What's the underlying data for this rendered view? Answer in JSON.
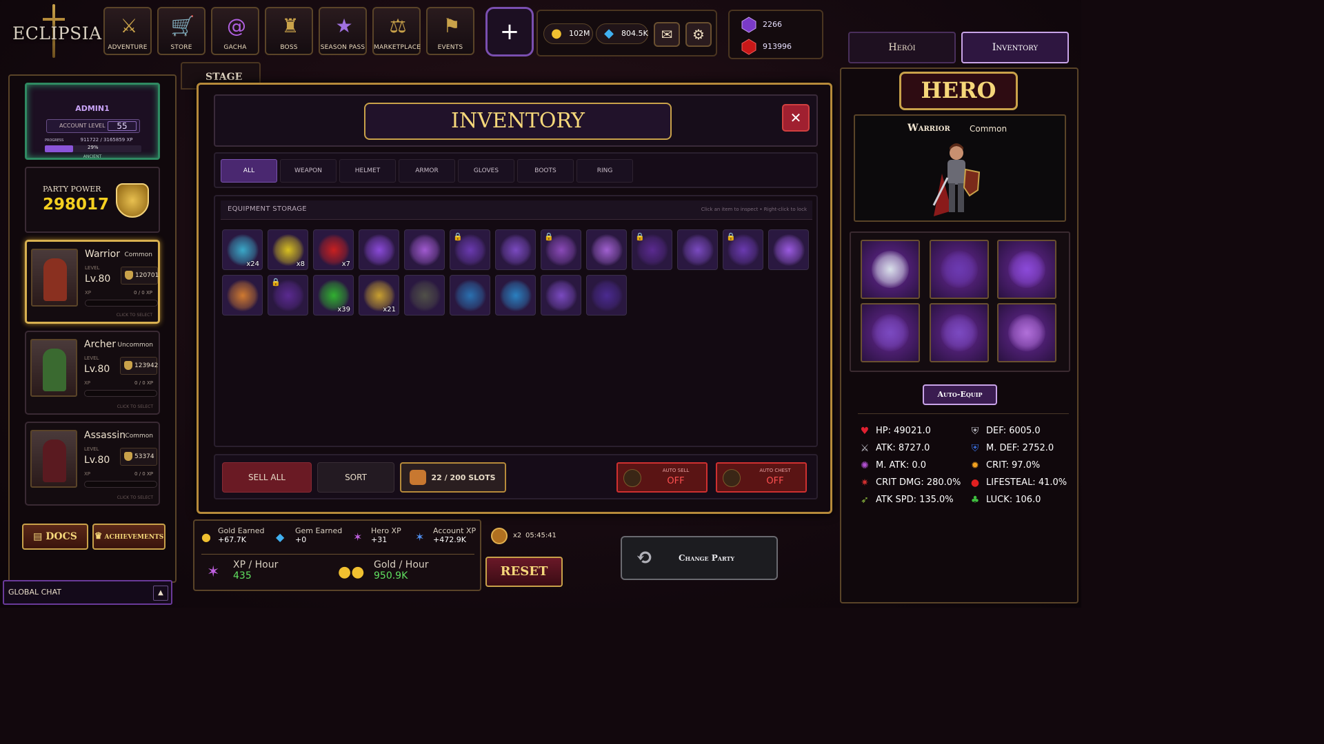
{
  "logo": {
    "text": "ECLIPSIA"
  },
  "nav": [
    {
      "label": "ADVENTURE",
      "icon": "crossed-swords-icon"
    },
    {
      "label": "STORE",
      "icon": "cart-icon"
    },
    {
      "label": "GACHA",
      "icon": "vortex-icon"
    },
    {
      "label": "BOSS",
      "icon": "horned-helmet-icon"
    },
    {
      "label": "SEASON PASS",
      "icon": "star-shield-icon"
    },
    {
      "label": "MARKETPLACE",
      "icon": "scales-icon"
    },
    {
      "label": "EVENTS",
      "icon": "banner-icon"
    }
  ],
  "currency": {
    "gold": "102M",
    "diamonds": "804.5K"
  },
  "gems": {
    "purple": "2266",
    "red": "913996"
  },
  "top_tabs": {
    "heroes": "Herói",
    "inventory": "Inventory"
  },
  "profile": {
    "name": "ADMIN1",
    "account_level_label": "ACCOUNT LEVEL",
    "account_level": "55",
    "progress_label": "PROGRESS",
    "xp_text": "911722 / 3165859 XP",
    "percent_text": "29%",
    "progress_fraction": 0.29,
    "rank": "ANCIENT"
  },
  "party_power": {
    "label": "PARTY POWER",
    "value": "298017"
  },
  "heroes": [
    {
      "name": "Warrior",
      "rarity": "Common",
      "level_label": "LEVEL",
      "level": "Lv.80",
      "power": "120701",
      "xp_label": "XP",
      "xp": "0 / 0 XP",
      "hint": "CLICK TO SELECT",
      "selected": true
    },
    {
      "name": "Archer",
      "rarity": "Uncommon",
      "level_label": "LEVEL",
      "level": "Lv.80",
      "power": "123942",
      "xp_label": "XP",
      "xp": "0 / 0 XP",
      "hint": "CLICK TO SELECT",
      "selected": false
    },
    {
      "name": "Assassin",
      "rarity": "Common",
      "level_label": "LEVEL",
      "level": "Lv.80",
      "power": "53374",
      "xp_label": "XP",
      "xp": "0 / 0 XP",
      "hint": "CLICK TO SELECT",
      "selected": false
    }
  ],
  "buttons": {
    "docs": "DOCS",
    "achievements": "ACHIEVEMENTS"
  },
  "chat": {
    "label": "GLOBAL CHAT",
    "toggle": "▲"
  },
  "stage_tab": "STAGE",
  "inventory": {
    "title": "INVENTORY",
    "close": "✕",
    "filters": [
      "ALL",
      "WEAPON",
      "HELMET",
      "ARMOR",
      "GLOVES",
      "BOOTS",
      "RING"
    ],
    "active_filter": "ALL",
    "storage_label": "EQUIPMENT STORAGE",
    "storage_hint": "Click an item to inspect • Right-click to lock",
    "items": [
      {
        "kind": "staff",
        "color": "#3aa8c8",
        "qty": "x24",
        "locked": false
      },
      {
        "kind": "staff",
        "color": "#d8c020",
        "qty": "x8",
        "locked": false
      },
      {
        "kind": "staff",
        "color": "#c82020",
        "qty": "x7",
        "locked": false
      },
      {
        "kind": "armor",
        "color": "#8a4ad8",
        "qty": "",
        "locked": false
      },
      {
        "kind": "ring",
        "color": "#a05ad0",
        "qty": "",
        "locked": false
      },
      {
        "kind": "gloves",
        "color": "#6a3ab0",
        "qty": "",
        "locked": true
      },
      {
        "kind": "gloves",
        "color": "#7a4ac0",
        "qty": "",
        "locked": false
      },
      {
        "kind": "ring",
        "color": "#8a4ab8",
        "qty": "",
        "locked": true
      },
      {
        "kind": "ring",
        "color": "#a060d0",
        "qty": "",
        "locked": false
      },
      {
        "kind": "armor",
        "color": "#5a2a90",
        "qty": "",
        "locked": true
      },
      {
        "kind": "boots",
        "color": "#7a4ac0",
        "qty": "",
        "locked": false
      },
      {
        "kind": "boots",
        "color": "#6a3ab0",
        "qty": "",
        "locked": true
      },
      {
        "kind": "weapon",
        "color": "#9a5ae0",
        "qty": "",
        "locked": false
      },
      {
        "kind": "hat",
        "color": "#d07a30",
        "qty": "",
        "locked": false
      },
      {
        "kind": "armor",
        "color": "#5a2a90",
        "qty": "",
        "locked": true
      },
      {
        "kind": "staff",
        "color": "#30b030",
        "qty": "x39",
        "locked": false
      },
      {
        "kind": "staff",
        "color": "#c8a030",
        "qty": "x21",
        "locked": false
      },
      {
        "kind": "staff",
        "color": "#505048",
        "qty": "",
        "locked": false
      },
      {
        "kind": "ring",
        "color": "#2a70b0",
        "qty": "",
        "locked": false
      },
      {
        "kind": "ring",
        "color": "#2a80c0",
        "qty": "",
        "locked": false
      },
      {
        "kind": "armor",
        "color": "#7a4ac0",
        "qty": "",
        "locked": false
      },
      {
        "kind": "gloves",
        "color": "#4a2a90",
        "qty": "",
        "locked": false
      }
    ],
    "sell_all": "SELL ALL",
    "sort": "SORT",
    "slots": "22 / 200 SLOTS",
    "auto_sell": {
      "label": "AUTO SELL",
      "value": "OFF"
    },
    "auto_chest": {
      "label": "AUTO CHEST",
      "value": "OFF"
    }
  },
  "stats_bar": {
    "gold_earned_label": "Gold Earned",
    "gold_earned": "+67.7K",
    "gem_earned_label": "Gem Earned",
    "gem_earned": "+0",
    "hero_xp_label": "Hero XP",
    "hero_xp": "+31",
    "account_xp_label": "Account XP",
    "account_xp": "+472.9K",
    "xp_hour_label": "XP / Hour",
    "xp_hour": "435",
    "gold_hour_label": "Gold / Hour",
    "gold_hour": "950.9K",
    "boost": "x2",
    "timer": "05:45:41",
    "reset": "RESET"
  },
  "change_party": "Change Party",
  "hero_panel": {
    "title": "HERO",
    "name": "Warrior",
    "rarity": "Common",
    "equipped": [
      {
        "slot": "helmet",
        "color": "#d8e0e8"
      },
      {
        "slot": "armor",
        "color": "#6a3ab0"
      },
      {
        "slot": "weapon",
        "color": "#8a4ad8"
      },
      {
        "slot": "boots",
        "color": "#7a4ac0"
      },
      {
        "slot": "gloves",
        "color": "#7a4ac0"
      },
      {
        "slot": "ring",
        "color": "#b070d8"
      }
    ],
    "auto_equip": "Auto-Equip",
    "stats": [
      {
        "text": "HP: 49021.0",
        "icon": "heart-icon",
        "color": "#e02030",
        "glyph": "♥"
      },
      {
        "text": "DEF: 6005.0",
        "icon": "shield-icon",
        "color": "#c8c8d0",
        "glyph": "⛨"
      },
      {
        "text": "ATK: 8727.0",
        "icon": "sword-icon",
        "color": "#c8c8d0",
        "glyph": "⚔"
      },
      {
        "text": "M. DEF: 2752.0",
        "icon": "blue-shield-icon",
        "color": "#3a70e0",
        "glyph": "⛨"
      },
      {
        "text": "M. ATK: 0.0",
        "icon": "magic-icon",
        "color": "#b050d0",
        "glyph": "✺"
      },
      {
        "text": "CRIT: 97.0%",
        "icon": "spark-icon",
        "color": "#f0a020",
        "glyph": "✹"
      },
      {
        "text": "CRIT DMG: 280.0%",
        "icon": "burst-icon",
        "color": "#d03030",
        "glyph": "✷"
      },
      {
        "text": "LIFESTEAL: 41.0%",
        "icon": "blood-drop-icon",
        "color": "#e02020",
        "glyph": "●"
      },
      {
        "text": "ATK SPD: 135.0%",
        "icon": "speed-icon",
        "color": "#90c040",
        "glyph": "➶"
      },
      {
        "text": "LUCK: 106.0",
        "icon": "clover-icon",
        "color": "#40c040",
        "glyph": "♣"
      }
    ]
  }
}
